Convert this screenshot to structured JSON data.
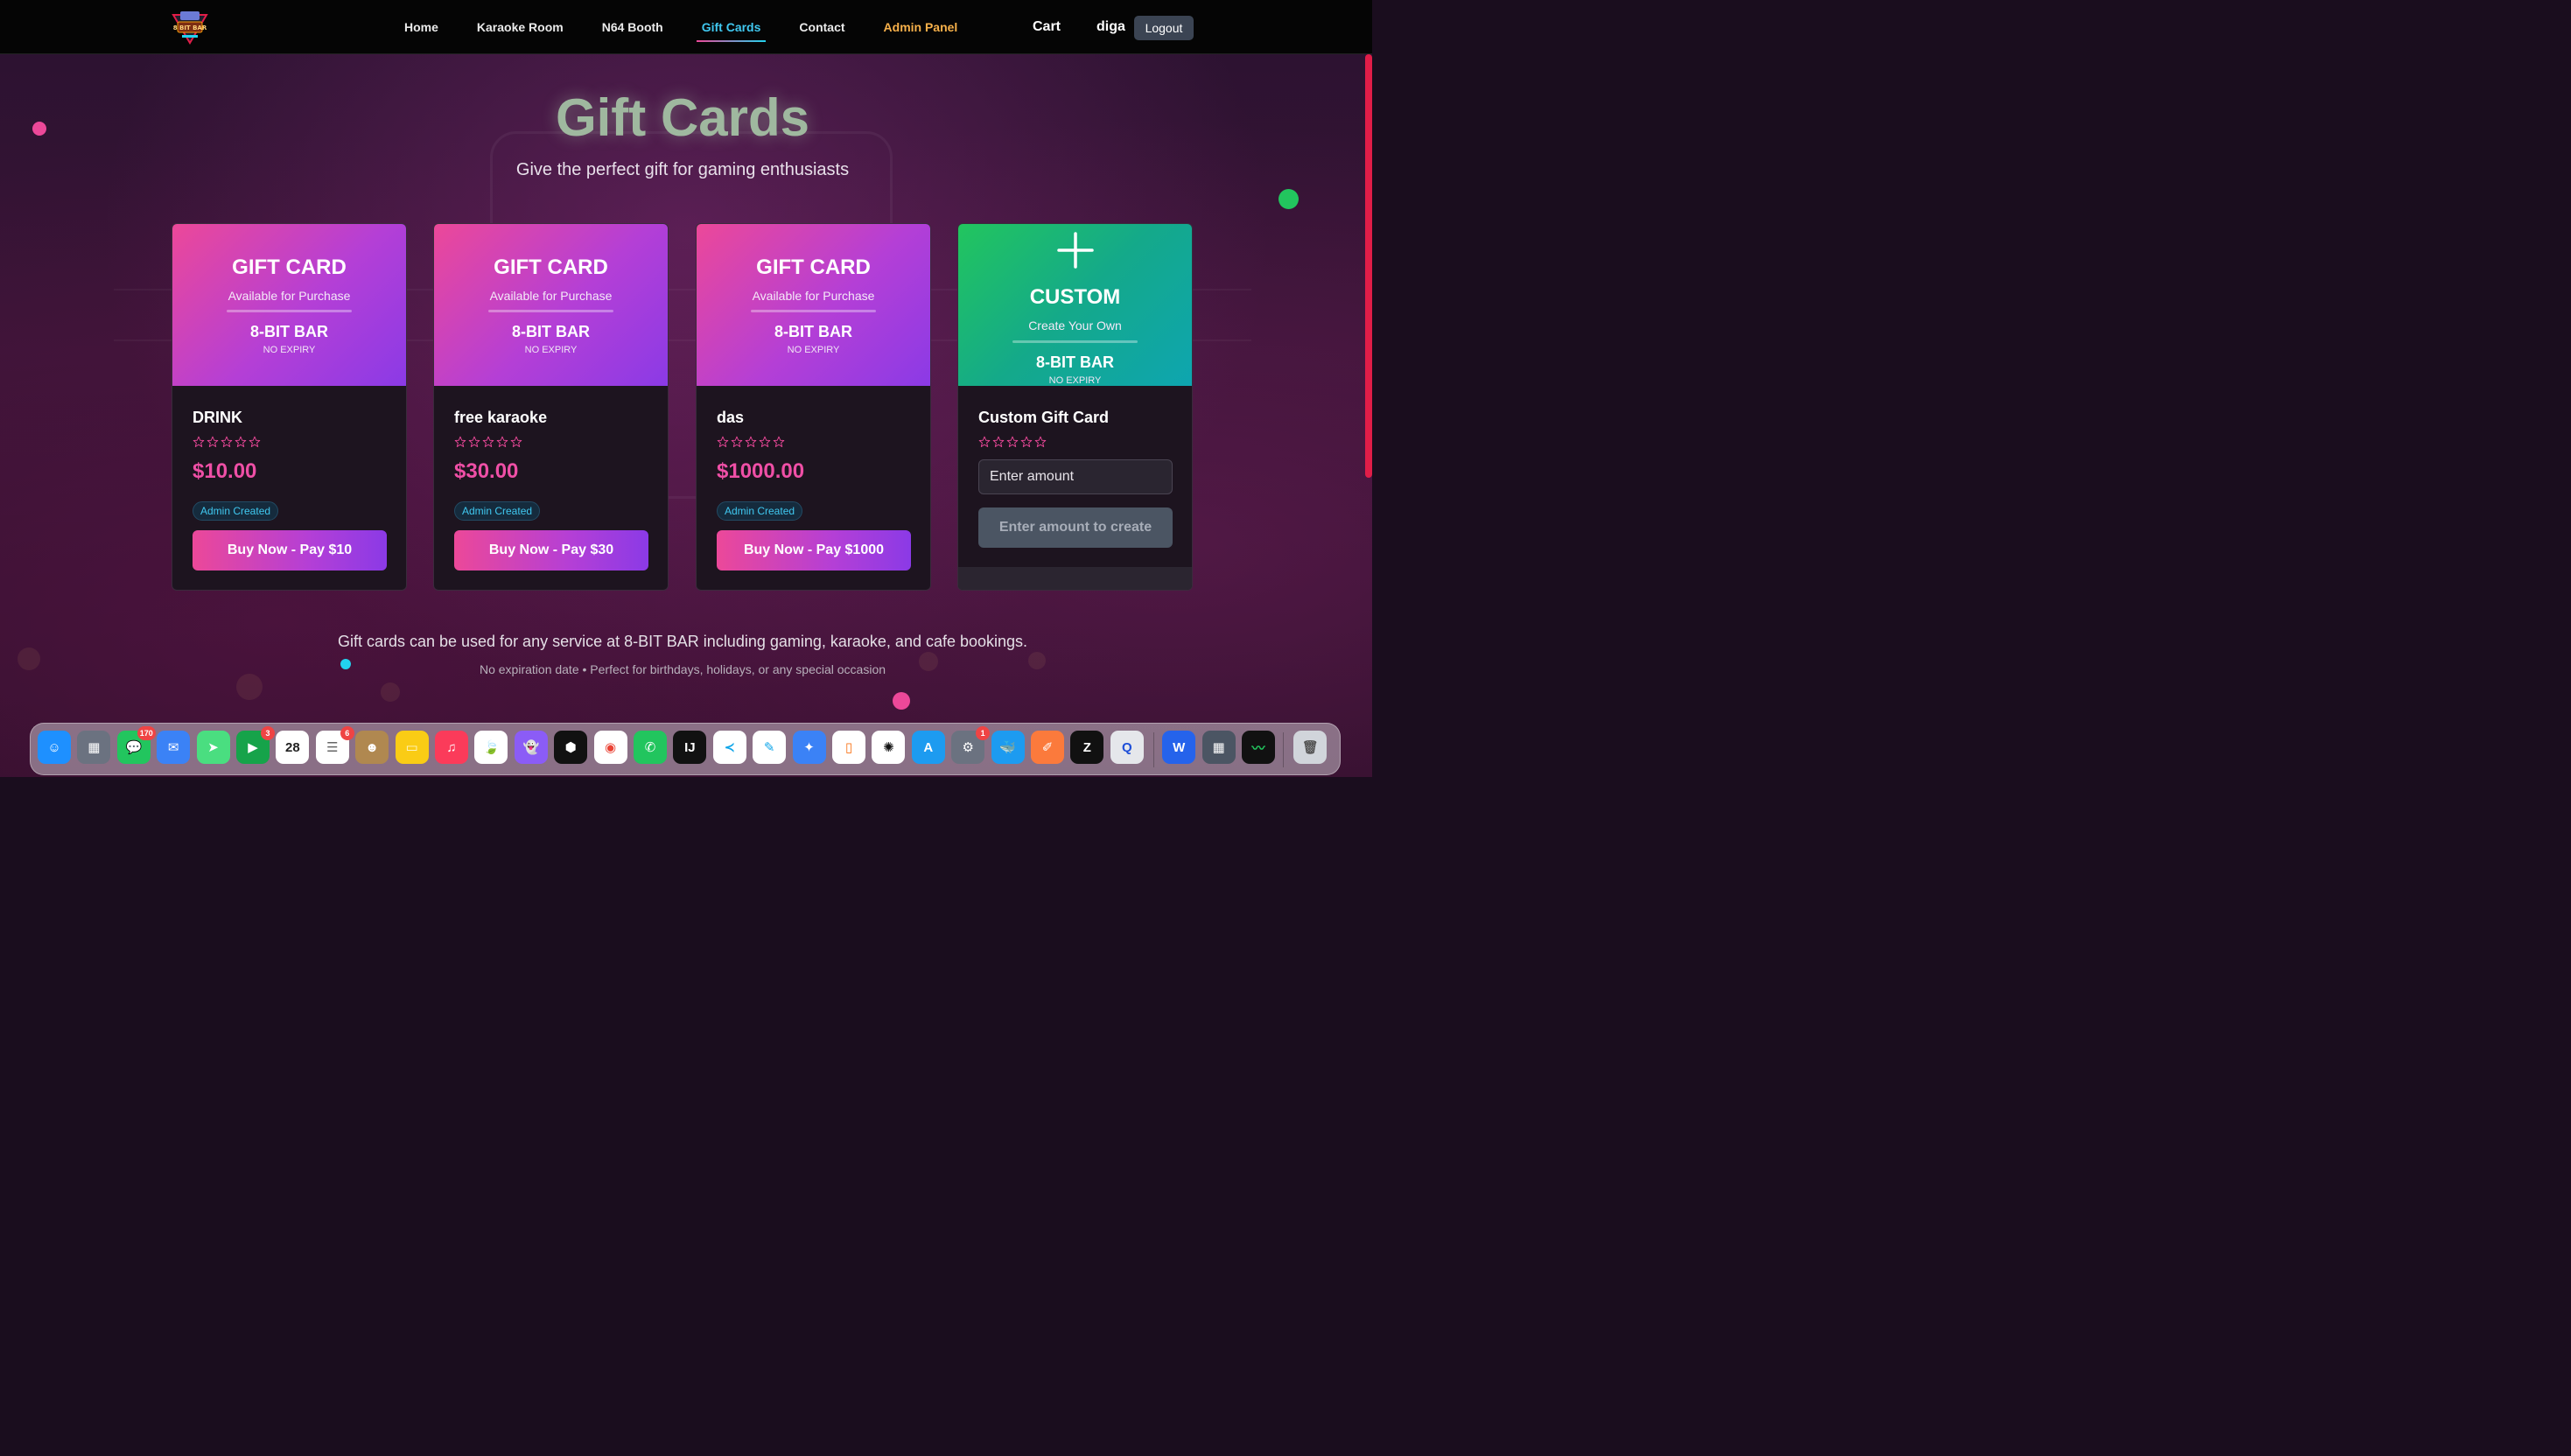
{
  "nav": {
    "links": [
      {
        "label": "Home"
      },
      {
        "label": "Karaoke Room"
      },
      {
        "label": "N64 Booth"
      },
      {
        "label": "Gift Cards"
      },
      {
        "label": "Contact"
      },
      {
        "label": "Admin Panel"
      }
    ],
    "active": "Gift Cards",
    "cart": "Cart",
    "user": "diga",
    "logout": "Logout",
    "logo_text": "8 BIT BAR"
  },
  "hero": {
    "title": "Gift Cards",
    "subtitle": "Give the perfect gift for gaming enthusiasts"
  },
  "cards": [
    {
      "top_title": "GIFT CARD",
      "top_sub": "Available for Purchase",
      "brand": "8-BIT BAR",
      "expiry": "NO EXPIRY",
      "name": "DRINK",
      "price": "$10.00",
      "badge": "Admin Created",
      "button": "Buy Now - Pay $10",
      "rating": 0
    },
    {
      "top_title": "GIFT CARD",
      "top_sub": "Available for Purchase",
      "brand": "8-BIT BAR",
      "expiry": "NO EXPIRY",
      "name": "free karaoke",
      "price": "$30.00",
      "badge": "Admin Created",
      "button": "Buy Now - Pay $30",
      "rating": 0
    },
    {
      "top_title": "GIFT CARD",
      "top_sub": "Available for Purchase",
      "brand": "8-BIT BAR",
      "expiry": "NO EXPIRY",
      "name": "das",
      "price": "$1000.00",
      "badge": "Admin Created",
      "button": "Buy Now - Pay $1000",
      "rating": 0
    }
  ],
  "custom_card": {
    "top_title": "CUSTOM",
    "top_sub": "Create Your Own",
    "brand": "8-BIT BAR",
    "expiry": "NO EXPIRY",
    "name": "Custom Gift Card",
    "rating": 0,
    "amount_placeholder": "Enter amount",
    "button": "Enter amount to create"
  },
  "info": {
    "line1": "Gift cards can be used for any service at 8-BIT BAR including gaming, karaoke, and cafe bookings.",
    "line2": "No expiration date • Perfect for birthdays, holidays, or any special occasion"
  },
  "colors": {
    "accent_pink": "#ec4899",
    "accent_purple": "#8b3ae6",
    "accent_cyan": "#40c8f0",
    "admin_orange": "#f6b04a",
    "custom_green": "#22c55e"
  },
  "dock": {
    "apps": [
      {
        "name": "finder-icon",
        "color": "#1e90ff",
        "glyph": "☺"
      },
      {
        "name": "launchpad-icon",
        "color": "#6b7280",
        "glyph": "▦"
      },
      {
        "name": "messages-icon",
        "color": "#22c55e",
        "glyph": "💬",
        "badge": "170"
      },
      {
        "name": "mail-icon",
        "color": "#3b82f6",
        "glyph": "✉"
      },
      {
        "name": "maps-icon",
        "color": "#4ade80",
        "glyph": "➤"
      },
      {
        "name": "facetime-icon",
        "color": "#16a34a",
        "glyph": "▶",
        "badge": "3"
      },
      {
        "name": "calendar-icon",
        "color": "#ffffff",
        "glyph": "28",
        "text_color": "#222"
      },
      {
        "name": "reminders-icon",
        "color": "#ffffff",
        "glyph": "☰",
        "badge": "6",
        "text_color": "#666"
      },
      {
        "name": "contacts-icon",
        "color": "#b08850",
        "glyph": "☻"
      },
      {
        "name": "notes-icon",
        "color": "#facc15",
        "glyph": "▭",
        "text_color": "#fff8d0"
      },
      {
        "name": "music-icon",
        "color": "#fb3b5a",
        "glyph": "♫"
      },
      {
        "name": "mongodb-icon",
        "color": "#ffffff",
        "glyph": "🍃",
        "text_color": "#16a34a"
      },
      {
        "name": "ghost-icon",
        "color": "#8b5cf6",
        "glyph": "👻"
      },
      {
        "name": "box-icon",
        "color": "#111111",
        "glyph": "⬢"
      },
      {
        "name": "chrome-icon",
        "color": "#ffffff",
        "glyph": "◉",
        "text_color": "#ea4335"
      },
      {
        "name": "whatsapp-icon",
        "color": "#22c55e",
        "glyph": "✆"
      },
      {
        "name": "intellij-icon",
        "color": "#111111",
        "glyph": "IJ"
      },
      {
        "name": "vscode-icon",
        "color": "#ffffff",
        "glyph": "≺",
        "text_color": "#0ea5e9"
      },
      {
        "name": "editor-icon",
        "color": "#ffffff",
        "glyph": "✎",
        "text_color": "#0ea5e9"
      },
      {
        "name": "safari-icon",
        "color": "#3b82f6",
        "glyph": "✦"
      },
      {
        "name": "simulator-icon",
        "color": "#ffffff",
        "glyph": "▯",
        "text_color": "#f97316"
      },
      {
        "name": "chatgpt-icon",
        "color": "#ffffff",
        "glyph": "✺",
        "text_color": "#111"
      },
      {
        "name": "appstore-icon",
        "color": "#1d9bf0",
        "glyph": "A"
      },
      {
        "name": "settings-icon",
        "color": "#6b7280",
        "glyph": "⚙",
        "badge": "1"
      },
      {
        "name": "docker-icon",
        "color": "#1d9bf0",
        "glyph": "🐳"
      },
      {
        "name": "postman-icon",
        "color": "#fb7a3c",
        "glyph": "✐"
      },
      {
        "name": "zed-icon",
        "color": "#111111",
        "glyph": "Z"
      },
      {
        "name": "quicktime-icon",
        "color": "#e5e7eb",
        "glyph": "Q",
        "text_color": "#1d4ed8"
      },
      {
        "name": "word-icon",
        "color": "#2563eb",
        "glyph": "W"
      },
      {
        "name": "calculator-icon",
        "color": "#4b5563",
        "glyph": "▦"
      },
      {
        "name": "activity-monitor-icon",
        "color": "#111111",
        "glyph": "〰",
        "text_color": "#22c55e"
      },
      {
        "name": "trash-icon",
        "color": "#d1d5db",
        "glyph": "🗑",
        "text_color": "#555"
      }
    ]
  }
}
